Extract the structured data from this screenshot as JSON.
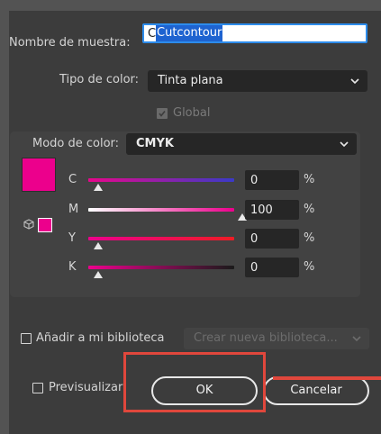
{
  "colors": {
    "dialog_bg": "#3c3c3c",
    "accent_blue": "#2d8ceb",
    "swatch": "#ec008c",
    "annotation_red": "#e0473c"
  },
  "swatch_name": {
    "label": "Nombre de muestra:",
    "value": "Cutcontour"
  },
  "color_type": {
    "label": "Tipo de color:",
    "value": "Tinta plana",
    "icon": "chevron-down-icon"
  },
  "global": {
    "label": "Global",
    "checked": true,
    "disabled": true
  },
  "color_mode": {
    "label": "Modo de color:",
    "value": "CMYK",
    "icon": "chevron-down-icon"
  },
  "channels": [
    {
      "name": "C",
      "value": "0",
      "unit": "%",
      "level": 0
    },
    {
      "name": "M",
      "value": "100",
      "unit": "%",
      "level": 1
    },
    {
      "name": "Y",
      "value": "0",
      "unit": "%",
      "level": 0
    },
    {
      "name": "K",
      "value": "0",
      "unit": "%",
      "level": 0
    }
  ],
  "library": {
    "label": "Añadir a mi biblioteca",
    "checked": false,
    "select_placeholder": "Crear nueva biblioteca..."
  },
  "preview": {
    "label": "Previsualizar",
    "checked": false
  },
  "buttons": {
    "ok": "OK",
    "cancel": "Cancelar"
  }
}
